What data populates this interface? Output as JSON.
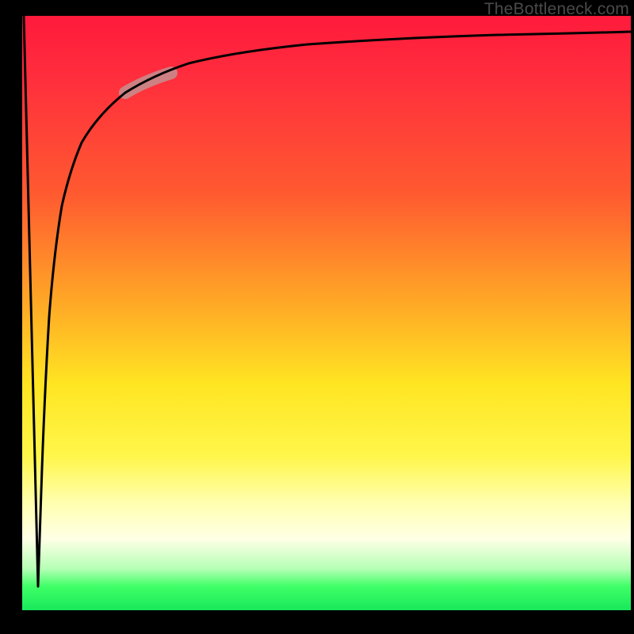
{
  "watermark": "TheBottleneck.com",
  "chart_data": {
    "type": "line",
    "title": "",
    "xlabel": "",
    "ylabel": "",
    "xlim": [
      0,
      100
    ],
    "ylim": [
      0,
      100
    ],
    "grid": false,
    "legend": false,
    "gradient_stops": [
      {
        "pos": 0,
        "color": "#ff1a3c"
      },
      {
        "pos": 10,
        "color": "#ff2d3d"
      },
      {
        "pos": 30,
        "color": "#ff5a30"
      },
      {
        "pos": 48,
        "color": "#ffa726"
      },
      {
        "pos": 62,
        "color": "#ffe522"
      },
      {
        "pos": 74,
        "color": "#fff64a"
      },
      {
        "pos": 82,
        "color": "#ffffb0"
      },
      {
        "pos": 88,
        "color": "#ffffe6"
      },
      {
        "pos": 93,
        "color": "#b6ffb6"
      },
      {
        "pos": 96,
        "color": "#3fff66"
      },
      {
        "pos": 100,
        "color": "#18e85b"
      }
    ],
    "series": [
      {
        "name": "curve",
        "x": [
          0,
          1.3,
          2.0,
          2.6,
          3.3,
          4.0,
          5.0,
          6.5,
          8.0,
          10,
          13,
          17,
          22,
          30,
          40,
          55,
          75,
          100
        ],
        "y": [
          100,
          70,
          40,
          4,
          40,
          55,
          65,
          72,
          77,
          81,
          84.5,
          87.5,
          90,
          92,
          93.2,
          94.2,
          95,
          95.8
        ]
      }
    ],
    "marker": {
      "name": "highlight-segment",
      "x_range": [
        17,
        24
      ],
      "y_range": [
        87,
        90
      ],
      "color": "#c48f8f"
    }
  }
}
